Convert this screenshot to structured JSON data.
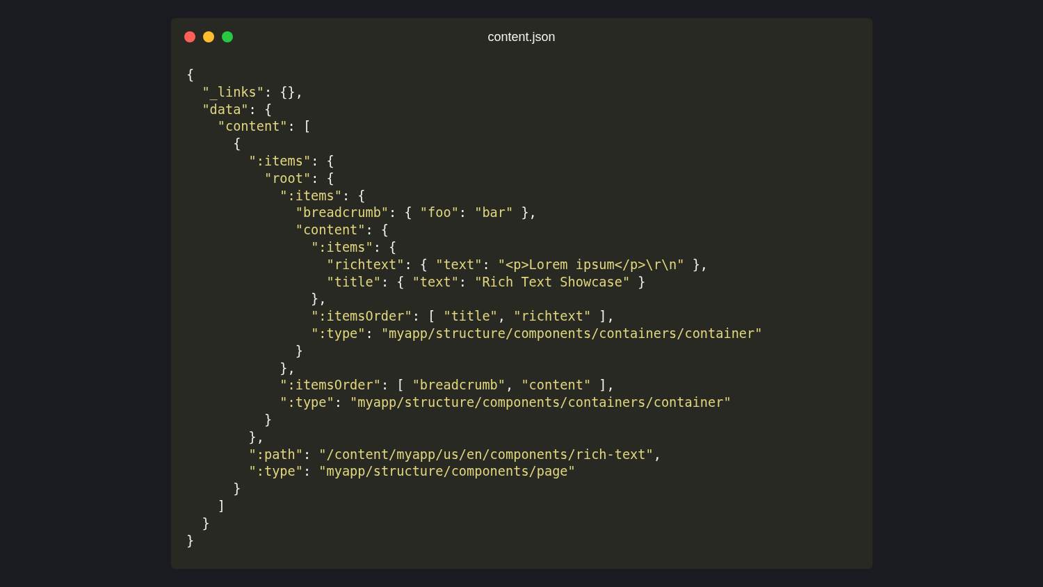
{
  "window": {
    "title": "content.json",
    "controls": [
      {
        "color": "#fe5f57"
      },
      {
        "color": "#febc2e"
      },
      {
        "color": "#28c840"
      }
    ]
  },
  "code_lines": [
    "{",
    "  \"_links\": {},",
    "  \"data\": {",
    "    \"content\": [",
    "      {",
    "        \":items\": {",
    "          \"root\": {",
    "            \":items\": {",
    "              \"breadcrumb\": { \"foo\": \"bar\" },",
    "              \"content\": {",
    "                \":items\": {",
    "                  \"richtext\": { \"text\": \"<p>Lorem ipsum</p>\\r\\n\" },",
    "                  \"title\": { \"text\": \"Rich Text Showcase\" }",
    "                },",
    "                \":itemsOrder\": [ \"title\", \"richtext\" ],",
    "                \":type\": \"myapp/structure/components/containers/container\"",
    "              }",
    "            },",
    "            \":itemsOrder\": [ \"breadcrumb\", \"content\" ],",
    "            \":type\": \"myapp/structure/components/containers/container\"",
    "          }",
    "        },",
    "        \":path\": \"/content/myapp/us/en/components/rich-text\",",
    "        \":type\": \"myapp/structure/components/page\"",
    "      }",
    "    ]",
    "  }",
    "}"
  ]
}
